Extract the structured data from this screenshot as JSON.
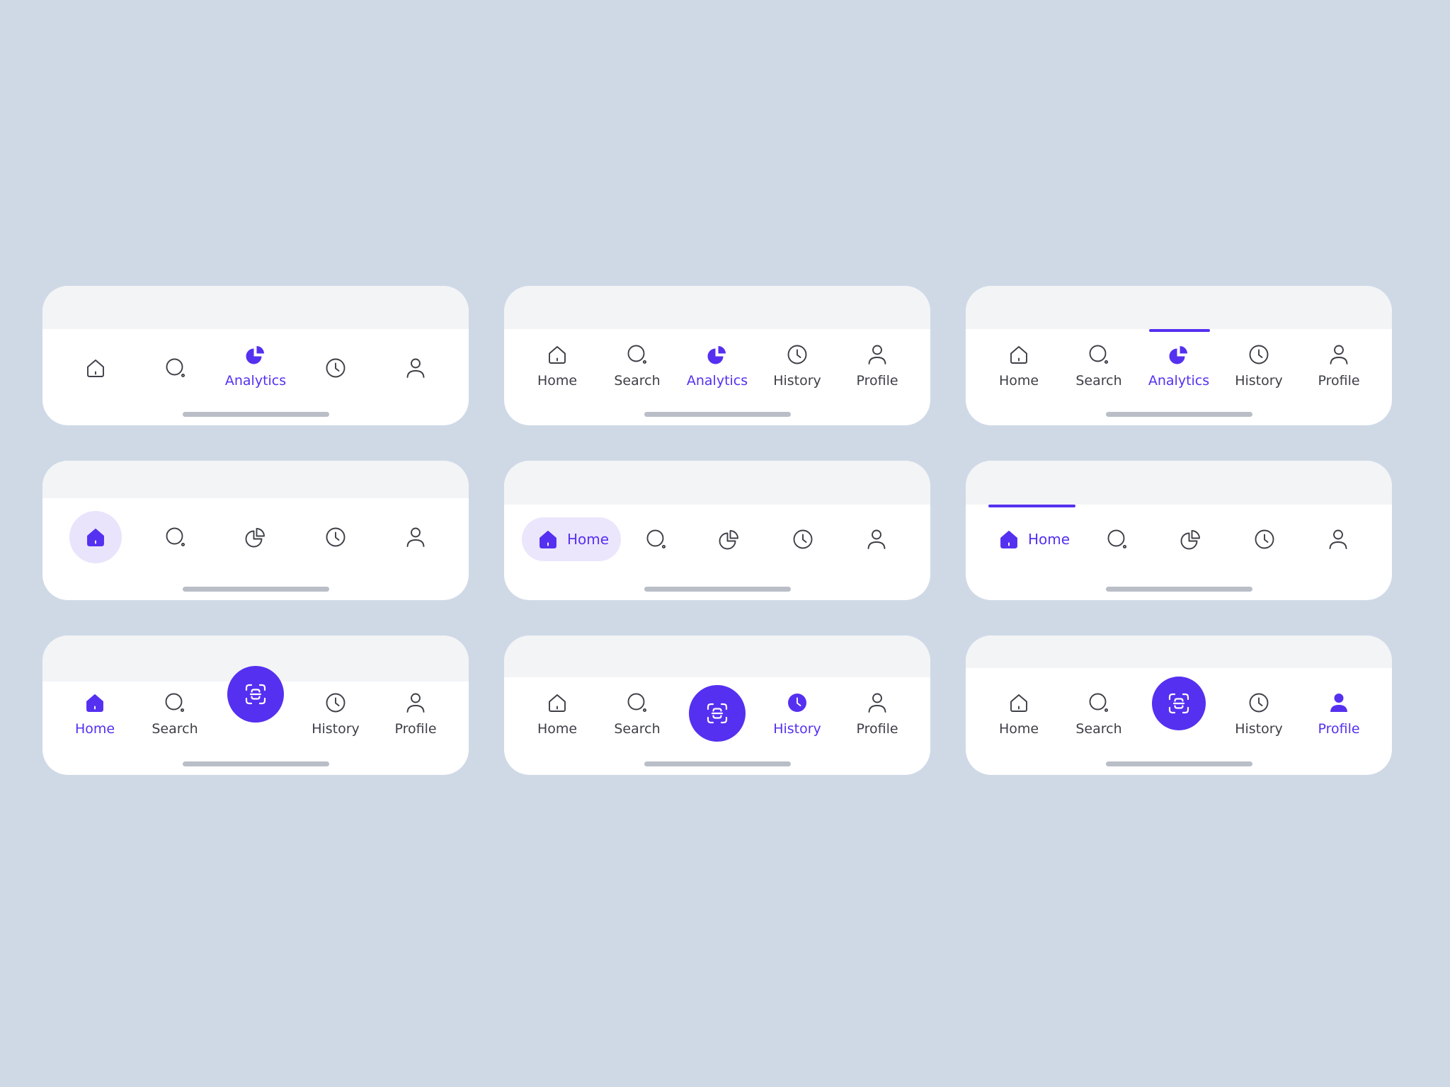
{
  "colors": {
    "background": "#cfd9e6",
    "accent": "#5530f0",
    "accent_light": "#e9e4fb",
    "icon": "#3c3f46",
    "card": "#ffffff",
    "topbar": "#f3f4f6"
  },
  "labels": {
    "home": "Home",
    "search": "Search",
    "analytics": "Analytics",
    "history": "History",
    "profile": "Profile"
  },
  "icons": [
    "home-icon",
    "search-icon",
    "analytics-icon",
    "history-icon",
    "profile-icon",
    "scan-icon"
  ],
  "variants": [
    {
      "name": "label-on-active",
      "active": "analytics"
    },
    {
      "name": "labels-all",
      "active": "analytics"
    },
    {
      "name": "labels-all-top-indicator",
      "active": "analytics"
    },
    {
      "name": "circle-highlight",
      "active": "home"
    },
    {
      "name": "pill-highlight",
      "active": "home"
    },
    {
      "name": "inline-label-top-indicator",
      "active": "home"
    },
    {
      "name": "fab-raised",
      "active": "home"
    },
    {
      "name": "fab-inline",
      "active": "history"
    },
    {
      "name": "fab-centered",
      "active": "profile"
    }
  ]
}
